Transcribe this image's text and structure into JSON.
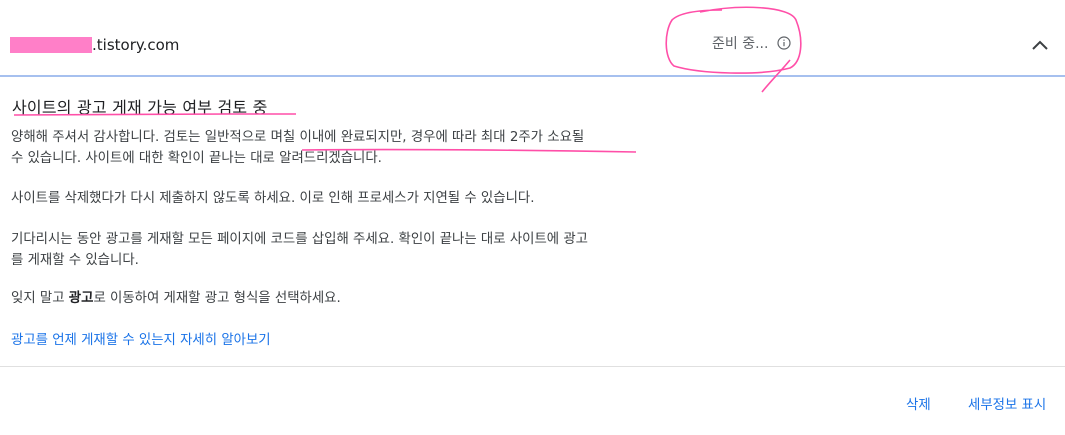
{
  "header": {
    "site_domain": ".tistory.com",
    "status_text": "준비 중...",
    "status_icon": "info-icon",
    "collapse_icon": "chevron-up-icon"
  },
  "content": {
    "title": "사이트의 광고 게재 가능 여부 검토 중",
    "paragraph1_line1": "양해해 주셔서 감사합니다. 검토는 일반적으로 며칠 이내에 완료되지만, 경우에 따라 최대 2주가 소요될",
    "paragraph1_line2": "수 있습니다. 사이트에 대한 확인이 끝나는 대로 알려드리겠습니다.",
    "paragraph2": "사이트를 삭제했다가 다시 제출하지 않도록 하세요. 이로 인해 프로세스가 지연될 수 있습니다.",
    "paragraph3_line1": "기다리시는 동안 광고를 게재할 모든 페이지에 코드를 삽입해 주세요. 확인이 끝나는 대로 사이트에 광고",
    "paragraph3_line2": "를 게재할 수 있습니다.",
    "paragraph4_prefix": "잊지 말고 ",
    "paragraph4_bold": "광고",
    "paragraph4_suffix": "로 이동하여 게재할 광고 형식을 선택하세요.",
    "learn_more_link": "광고를 언제 게재할 수 있는지 자세히 알아보기"
  },
  "footer": {
    "delete_label": "삭제",
    "details_label": "세부정보 표시"
  },
  "colors": {
    "link": "#1a73e8",
    "header_divider": "#a6c0ef",
    "annotation": "#ff4fa8",
    "redaction": "#ff7fc8"
  }
}
